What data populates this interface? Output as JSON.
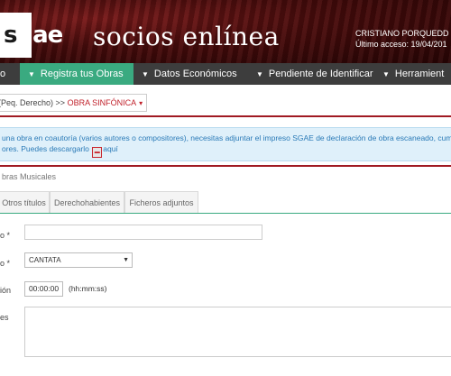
{
  "header": {
    "logo_light": "s",
    "logo_dark": "gae",
    "app_title": "socios enlínea",
    "user_name": "CRISTIANO PORQUEDD",
    "last_access": "Último acceso: 19/04/201"
  },
  "nav": {
    "items": [
      {
        "label": "o"
      },
      {
        "label": "Registra tus Obras"
      },
      {
        "label": "Datos Económicos"
      },
      {
        "label": "Pendiente de Identificar"
      },
      {
        "label": "Herramient"
      }
    ]
  },
  "breadcrumb": {
    "prefix": "Peq. Derecho) >>",
    "current": "OBRA SINFÓNICA",
    "caret": "▾"
  },
  "info": {
    "line1": "una obra en coautoría (varios autores o compositores), necesitas adjuntar el impreso SGAE de declaración de obra escaneado, cumpli",
    "line2_a": "ores. Puedes descargarlo",
    "line2_b": "aquí"
  },
  "section_title": "bras Musicales",
  "tabs": [
    "Otros títulos",
    "Derechohabientes",
    "Ficheros adjuntos"
  ],
  "form": {
    "label_title": "o *",
    "label_genre": "o *",
    "genre_value": "CANTATA",
    "label_duration": "ión",
    "duration_value": "00:00:00",
    "duration_hint": "(hh:mm:ss)",
    "label_notes": "es"
  }
}
